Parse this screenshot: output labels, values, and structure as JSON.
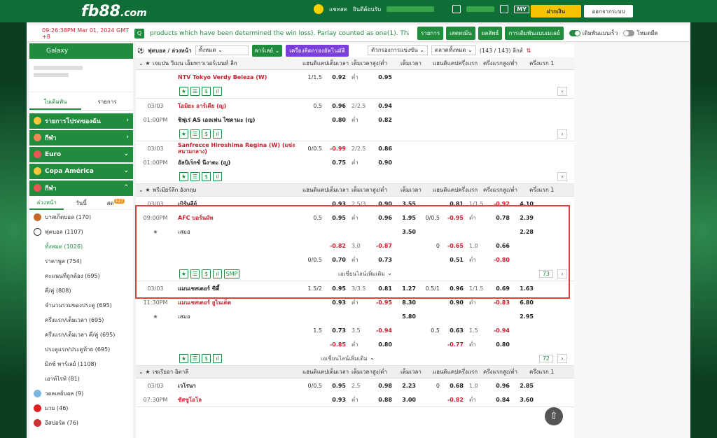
{
  "header": {
    "logo_main": "fb88",
    "logo_suffix": ".com",
    "chat_label": "แชทสด",
    "welcome": "ยินดีต้อนรับ",
    "odds_format": "MY",
    "deposit": "ฝากเงิน",
    "logout": "ออกจากระบบ"
  },
  "ticker": {
    "time": "09:26:38PM Mar 01, 2024 GMT +8",
    "message": "products which have been determined the win loss). Parlay counted as one(1). Thank you!",
    "btn_list": "รายการ",
    "btn_results": "เสตทเม้น",
    "btn_result2": "ผลลัพธ์",
    "btn_settings": "การเดิมพันแบบเมเลย์",
    "toggle_quick": "เดิมพันแบบเร็ว",
    "toggle_night": "โหมดมืด"
  },
  "sidebar": {
    "galaxy": "Galaxy",
    "tab_bets": "ใบเดิมพัน",
    "tab_list": "รายการ",
    "fav": "รายการโปรดของฉัน",
    "sports_top": "กีฬา",
    "euro": "Euro",
    "copa": "Copa América",
    "sports": "กีฬา",
    "sub_tabs": [
      "ล่วงหน้า",
      "วันนี้",
      "สด"
    ],
    "live_count": "127",
    "basketball": "บาสเก็ตบอล (170)",
    "football": "ฟุตบอล (1107)",
    "subitems": [
      "ทั้งหมด (1026)",
      "ราคาพูล (754)",
      "คะแนนที่ถูกต้อง (695)",
      "คี่/คู่ (808)",
      "จำนวนรวมของประตู (695)",
      "ครึ่งแรก/เต็มเวลา (695)",
      "ครึ่งแรก/เต็มเวลา คี่/คู่ (695)",
      "ประตูแรก/ประตูท้าย (695)",
      "มิกซ์ พาร์เลย์ (1108)",
      "เอาท์ไรท์ (81)"
    ],
    "volleyball": "วอลเลย์บอล (9)",
    "boxing": "มวย (46)",
    "esports": "อีสปอร์ต (76)"
  },
  "filter": {
    "sport": "ฟุตบอล / ล่วงหน้า",
    "all": "ทั้งหมด",
    "parlay": "พาร์เลย์",
    "calc": "เครื่องคิดกรองอัตโนมัติ",
    "filter_league": "ตัวกรองการแข่งขัน",
    "sort": "ตลาดทั้งหมด",
    "count": "(143 / 143) ลีกส์"
  },
  "columns": [
    "แฮนดิแคปเต็มเวลา",
    "เต็มเวลาสูง/ต่ำ",
    "เต็มเวลา",
    "แฮนดิแคปครึ่งแรก",
    "ครึ่งแรกสูง/ต่ำ",
    "ครึ่งแรก 1"
  ],
  "league1": "เจแปน วีเมน เอ็มพาวเวอร์เมนท์ ลีก",
  "match0": {
    "team": "NTV Tokyo Verdy Beleza (W)",
    "hc": "1/1.5",
    "o1": "0.92",
    "lab": "ต่ำ",
    "o2": "0.95"
  },
  "match1": {
    "date": "03/03",
    "time": "01:00PM",
    "home": "โอมิยะ อาร์เดีย (ญ)",
    "away": "ชิฟุเร่ AS เอลเฟน ไซตามะ (ญ)",
    "hc": "0.5",
    "h1": "0.96",
    "ou": "2/2.5",
    "o1": "0.94",
    "h2": "0.80",
    "lab": "ต่ำ",
    "o2": "0.82"
  },
  "match2": {
    "date": "03/03",
    "time": "01:00PM",
    "home": "Sanfrecce Hiroshima Regina (W) (แข่งสนามกลาง)",
    "away": "อัลบิเร็กซ์ นีงาตะ (ญ)",
    "hc": "0/0.5",
    "h1": "-0.99",
    "ou": "2/2.5",
    "o1": "0.86",
    "h2": "0.75",
    "lab": "ต่ำ",
    "o2": "0.90"
  },
  "league2": "พรีเมียร์ลีก อังกฤษ",
  "match3": {
    "date": "03/03",
    "time": "09:00PM",
    "home": "เบิร์นลีย์",
    "away": "AFC บอร์นมัท",
    "draw": "เสมอ",
    "r1": [
      "",
      "0.93",
      "2.5/3",
      "0.90",
      "3.55",
      "",
      "0.81",
      "1/1.5",
      "-0.92",
      "4.10"
    ],
    "r2": [
      "0.5",
      "0.95",
      "ต่ำ",
      "0.96",
      "1.95",
      "0/0.5",
      "-0.95",
      "ต่ำ",
      "0.78",
      "2.39"
    ],
    "r3": [
      "",
      "",
      "",
      "",
      "3.50",
      "",
      "",
      "",
      "",
      "2.28"
    ],
    "r4": [
      "",
      "-0.82",
      "3.0",
      "-0.87",
      "",
      "0",
      "-0.65",
      "1.0",
      "0.66",
      ""
    ],
    "r5": [
      "0/0.5",
      "0.70",
      "ต่ำ",
      "0.73",
      "",
      "",
      "0.51",
      "ต่ำ",
      "-0.80",
      ""
    ],
    "more_lines": "เอเชี่ยนไลน์เพิ่มเติม",
    "count": "73",
    "smp": "SMP"
  },
  "match4": {
    "date": "03/03",
    "time": "11:30PM",
    "home": "แมนเชสเตอร์ ซิตี้",
    "away": "แมนเชสเตอร์ ยูไนเต็ด",
    "draw": "เสมอ",
    "r1": [
      "1.5/2",
      "0.95",
      "3/3.5",
      "0.81",
      "1.27",
      "0.5/1",
      "0.96",
      "1/1.5",
      "0.69",
      "1.63"
    ],
    "r2": [
      "",
      "0.93",
      "ต่ำ",
      "-0.95",
      "8.30",
      "",
      "0.90",
      "ต่ำ",
      "-0.83",
      "6.80"
    ],
    "r3": [
      "",
      "",
      "",
      "",
      "5.80",
      "",
      "",
      "",
      "",
      "2.95"
    ],
    "r4": [
      "1.5",
      "0.73",
      "3.5",
      "-0.94",
      "",
      "0.5",
      "0.63",
      "1.5",
      "-0.94",
      ""
    ],
    "r5": [
      "",
      "-0.85",
      "ต่ำ",
      "0.80",
      "",
      "",
      "-0.77",
      "ต่ำ",
      "0.80",
      ""
    ],
    "count": "72"
  },
  "league3": "เซเรียอา อิตาลี",
  "match5": {
    "date": "03/03",
    "time": "07:30PM",
    "home": "เวโรนา",
    "away": "ซัสซูโอโล",
    "draw": "เสมอ",
    "r1": [
      "0/0.5",
      "0.95",
      "2.5",
      "0.98",
      "2.23",
      "0",
      "0.68",
      "1.0",
      "0.96",
      "2.85"
    ],
    "r2": [
      "",
      "0.93",
      "ต่ำ",
      "0.88",
      "3.00",
      "",
      "-0.82",
      "ต่ำ",
      "0.84",
      "3.60"
    ]
  }
}
